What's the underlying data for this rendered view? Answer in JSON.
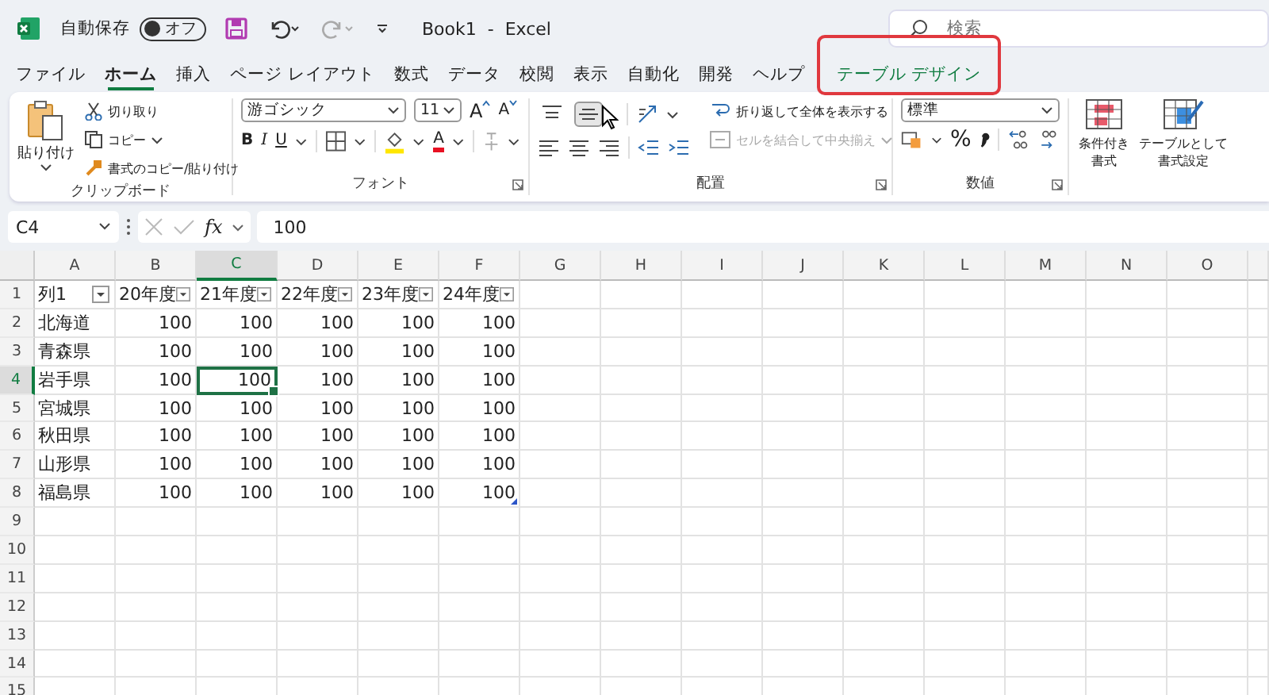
{
  "title_bar": {
    "autosave_label": "自動保存",
    "autosave_toggle": {
      "label": "オフ",
      "on": false
    },
    "document_title": "Book1  -  Excel",
    "search": {
      "placeholder": "検索"
    }
  },
  "tabs": [
    {
      "label": "ファイル",
      "selected": false,
      "kind": "normal",
      "outlined": false
    },
    {
      "label": "ホーム",
      "selected": true,
      "kind": "normal",
      "outlined": false
    },
    {
      "label": "挿入",
      "selected": false,
      "kind": "normal",
      "outlined": false
    },
    {
      "label": "ページ レイアウト",
      "selected": false,
      "kind": "normal",
      "outlined": false
    },
    {
      "label": "数式",
      "selected": false,
      "kind": "normal",
      "outlined": false
    },
    {
      "label": "データ",
      "selected": false,
      "kind": "normal",
      "outlined": false
    },
    {
      "label": "校閲",
      "selected": false,
      "kind": "normal",
      "outlined": false
    },
    {
      "label": "表示",
      "selected": false,
      "kind": "normal",
      "outlined": false
    },
    {
      "label": "自動化",
      "selected": false,
      "kind": "normal",
      "outlined": false
    },
    {
      "label": "開発",
      "selected": false,
      "kind": "normal",
      "outlined": false
    },
    {
      "label": "ヘルプ",
      "selected": false,
      "kind": "normal",
      "outlined": false
    },
    {
      "label": "テーブル デザイン",
      "selected": false,
      "kind": "contextual",
      "outlined": true
    }
  ],
  "ribbon": {
    "clipboard": {
      "paste": "貼り付け",
      "cut": "切り取り",
      "copy": "コピー",
      "format_painter": "書式のコピー/貼り付け",
      "label": "クリップボード"
    },
    "font": {
      "font_name": "游ゴシック",
      "font_size": "11",
      "grow": "A",
      "shrink": "A",
      "bold": "B",
      "italic": "I",
      "underline": "U",
      "font_color": "A",
      "label": "フォント"
    },
    "alignment": {
      "vertical_align": [
        {
          "kind": "top",
          "selected": false
        },
        {
          "kind": "middle",
          "selected": true
        }
      ],
      "wrap_text": "折り返して全体を表示する",
      "merge_center": {
        "label": "セルを結合して中央揃え",
        "disabled": true
      },
      "label": "配置"
    },
    "number": {
      "format": "標準",
      "percent": "%",
      "label": "数値"
    },
    "styles": {
      "conditional_format": [
        "条件付き",
        "書式"
      ],
      "format_as_table": [
        "テーブルとして",
        "書式設定"
      ]
    }
  },
  "formula_bar": {
    "name_box": "C4",
    "fx": "fx",
    "formula": "100"
  },
  "sheet": {
    "columns": [
      {
        "label": "A",
        "selected": false
      },
      {
        "label": "B",
        "selected": false
      },
      {
        "label": "C",
        "selected": true
      },
      {
        "label": "D",
        "selected": false
      },
      {
        "label": "E",
        "selected": false
      },
      {
        "label": "F",
        "selected": false
      },
      {
        "label": "G",
        "selected": false
      },
      {
        "label": "H",
        "selected": false
      },
      {
        "label": "I",
        "selected": false
      },
      {
        "label": "J",
        "selected": false
      },
      {
        "label": "K",
        "selected": false
      },
      {
        "label": "L",
        "selected": false
      },
      {
        "label": "M",
        "selected": false
      },
      {
        "label": "N",
        "selected": false
      },
      {
        "label": "O",
        "selected": false
      }
    ],
    "rows": [
      {
        "header": "1",
        "selected": false,
        "cells": [
          {
            "value": "列1",
            "kind": "header",
            "selected": false
          },
          {
            "value": "20年度",
            "kind": "header",
            "selected": false
          },
          {
            "value": "21年度",
            "kind": "header",
            "selected": false
          },
          {
            "value": "22年度",
            "kind": "header",
            "selected": false
          },
          {
            "value": "23年度",
            "kind": "header",
            "selected": false
          },
          {
            "value": "24年度",
            "kind": "header",
            "selected": false
          }
        ]
      },
      {
        "header": "2",
        "selected": false,
        "cells": [
          {
            "value": "北海道",
            "kind": "text",
            "selected": false
          },
          {
            "value": "100",
            "kind": "number",
            "selected": false
          },
          {
            "value": "100",
            "kind": "number",
            "selected": false
          },
          {
            "value": "100",
            "kind": "number",
            "selected": false
          },
          {
            "value": "100",
            "kind": "number",
            "selected": false
          },
          {
            "value": "100",
            "kind": "number",
            "selected": false
          }
        ]
      },
      {
        "header": "3",
        "selected": false,
        "cells": [
          {
            "value": "青森県",
            "kind": "text",
            "selected": false
          },
          {
            "value": "100",
            "kind": "number",
            "selected": false
          },
          {
            "value": "100",
            "kind": "number",
            "selected": false
          },
          {
            "value": "100",
            "kind": "number",
            "selected": false
          },
          {
            "value": "100",
            "kind": "number",
            "selected": false
          },
          {
            "value": "100",
            "kind": "number",
            "selected": false
          }
        ]
      },
      {
        "header": "4",
        "selected": true,
        "cells": [
          {
            "value": "岩手県",
            "kind": "text",
            "selected": false
          },
          {
            "value": "100",
            "kind": "number",
            "selected": false
          },
          {
            "value": "100",
            "kind": "number",
            "selected": true
          },
          {
            "value": "100",
            "kind": "number",
            "selected": false
          },
          {
            "value": "100",
            "kind": "number",
            "selected": false
          },
          {
            "value": "100",
            "kind": "number",
            "selected": false
          }
        ]
      },
      {
        "header": "5",
        "selected": false,
        "cells": [
          {
            "value": "宮城県",
            "kind": "text",
            "selected": false
          },
          {
            "value": "100",
            "kind": "number",
            "selected": false
          },
          {
            "value": "100",
            "kind": "number",
            "selected": false
          },
          {
            "value": "100",
            "kind": "number",
            "selected": false
          },
          {
            "value": "100",
            "kind": "number",
            "selected": false
          },
          {
            "value": "100",
            "kind": "number",
            "selected": false
          }
        ]
      },
      {
        "header": "6",
        "selected": false,
        "cells": [
          {
            "value": "秋田県",
            "kind": "text",
            "selected": false
          },
          {
            "value": "100",
            "kind": "number",
            "selected": false
          },
          {
            "value": "100",
            "kind": "number",
            "selected": false
          },
          {
            "value": "100",
            "kind": "number",
            "selected": false
          },
          {
            "value": "100",
            "kind": "number",
            "selected": false
          },
          {
            "value": "100",
            "kind": "number",
            "selected": false
          }
        ]
      },
      {
        "header": "7",
        "selected": false,
        "cells": [
          {
            "value": "山形県",
            "kind": "text",
            "selected": false
          },
          {
            "value": "100",
            "kind": "number",
            "selected": false
          },
          {
            "value": "100",
            "kind": "number",
            "selected": false
          },
          {
            "value": "100",
            "kind": "number",
            "selected": false
          },
          {
            "value": "100",
            "kind": "number",
            "selected": false
          },
          {
            "value": "100",
            "kind": "number",
            "selected": false
          }
        ]
      },
      {
        "header": "8",
        "selected": false,
        "cells": [
          {
            "value": "福島県",
            "kind": "text",
            "selected": false
          },
          {
            "value": "100",
            "kind": "number",
            "selected": false
          },
          {
            "value": "100",
            "kind": "number",
            "selected": false
          },
          {
            "value": "100",
            "kind": "number",
            "selected": false
          },
          {
            "value": "100",
            "kind": "number",
            "selected": false
          },
          {
            "value": "100",
            "kind": "number",
            "selected": false
          }
        ]
      },
      {
        "header": "9",
        "selected": false,
        "cells": []
      },
      {
        "header": "10",
        "selected": false,
        "cells": []
      },
      {
        "header": "11",
        "selected": false,
        "cells": []
      },
      {
        "header": "12",
        "selected": false,
        "cells": []
      },
      {
        "header": "13",
        "selected": false,
        "cells": []
      },
      {
        "header": "14",
        "selected": false,
        "cells": []
      },
      {
        "header": "15",
        "selected": false,
        "cells": []
      }
    ]
  }
}
